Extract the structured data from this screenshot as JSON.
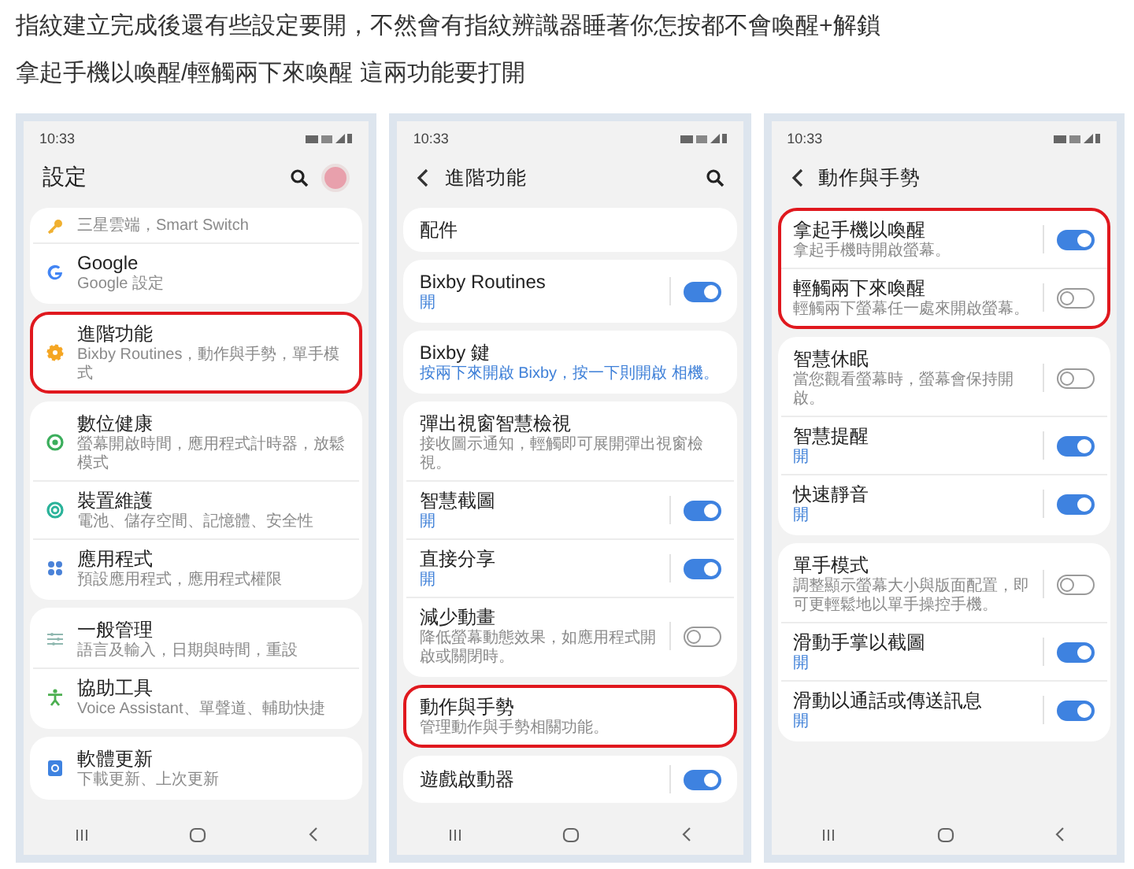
{
  "intro": [
    "指紋建立完成後還有些設定要開，不然會有指紋辨識器睡著你怎按都不會喚醒+解鎖",
    "拿起手機以喚醒/輕觸兩下來喚醒 這兩功能要打開"
  ],
  "phones": [
    {
      "time": "10:33",
      "title": "設定",
      "back_button": false,
      "search_button": true,
      "profile_avatar": true,
      "cards": [
        {
          "highlighted": false,
          "items": [
            {
              "kind": "link",
              "subtitle": "三星雲端，Smart Switch",
              "subtitle_highlighted": false
            },
            {
              "kind": "link",
              "title": "Google",
              "subtitle": "Google 設定",
              "subtitle_highlighted": false
            }
          ]
        },
        {
          "highlighted": true,
          "items": [
            {
              "kind": "link",
              "title": "進階功能",
              "subtitle": "Bixby Routines，動作與手勢，單手模式",
              "subtitle_highlighted": false
            }
          ]
        },
        {
          "highlighted": false,
          "items": [
            {
              "kind": "link",
              "title": "數位健康",
              "subtitle": "螢幕開啟時間，應用程式計時器，放鬆模式",
              "subtitle_highlighted": false
            },
            {
              "kind": "link",
              "title": "裝置維護",
              "subtitle": "電池、儲存空間、記憶體、安全性",
              "subtitle_highlighted": false
            },
            {
              "kind": "link",
              "title": "應用程式",
              "subtitle": "預設應用程式，應用程式權限",
              "subtitle_highlighted": false
            }
          ]
        },
        {
          "highlighted": false,
          "items": [
            {
              "kind": "link",
              "title": "一般管理",
              "subtitle": "語言及輸入，日期與時間，重設",
              "subtitle_highlighted": false
            },
            {
              "kind": "link",
              "title": "協助工具",
              "subtitle": "Voice Assistant、單聲道、輔助快捷",
              "subtitle_highlighted": false
            }
          ]
        },
        {
          "highlighted": false,
          "items": [
            {
              "kind": "link",
              "title": "軟體更新",
              "subtitle": "下載更新、上次更新",
              "subtitle_highlighted": false
            }
          ]
        }
      ]
    },
    {
      "time": "10:33",
      "title": "進階功能",
      "back_button": true,
      "search_button": true,
      "profile_avatar": false,
      "cards": [
        {
          "highlighted": false,
          "items": [
            {
              "kind": "link",
              "title": "配件"
            }
          ]
        },
        {
          "highlighted": false,
          "items": [
            {
              "kind": "toggle",
              "title": "Bixby Routines",
              "subtitle": "開",
              "subtitle_highlighted": true,
              "on": true
            }
          ]
        },
        {
          "highlighted": false,
          "items": [
            {
              "kind": "link",
              "title": "Bixby 鍵",
              "subtitle": "按兩下來開啟 Bixby，按一下則開啟 相機。",
              "subtitle_highlighted": true
            }
          ]
        },
        {
          "highlighted": false,
          "items": [
            {
              "kind": "link",
              "title": "彈出視窗智慧檢視",
              "subtitle": "接收圖示通知，輕觸即可展開彈出視窗檢視。",
              "subtitle_highlighted": false
            },
            {
              "kind": "toggle",
              "title": "智慧截圖",
              "subtitle": "開",
              "subtitle_highlighted": true,
              "on": true
            },
            {
              "kind": "toggle",
              "title": "直接分享",
              "subtitle": "開",
              "subtitle_highlighted": true,
              "on": true
            },
            {
              "kind": "toggle",
              "title": "減少動畫",
              "subtitle": "降低螢幕動態效果，如應用程式開啟或關閉時。",
              "subtitle_highlighted": false,
              "on": false
            }
          ]
        },
        {
          "highlighted": true,
          "items": [
            {
              "kind": "link",
              "title": "動作與手勢",
              "subtitle": "管理動作與手勢相關功能。",
              "subtitle_highlighted": false
            }
          ]
        },
        {
          "highlighted": false,
          "items": [
            {
              "kind": "toggle",
              "title": "遊戲啟動器",
              "on": true
            }
          ]
        }
      ]
    },
    {
      "time": "10:33",
      "title": "動作與手勢",
      "back_button": true,
      "search_button": false,
      "profile_avatar": false,
      "cards": [
        {
          "highlighted": true,
          "items": [
            {
              "kind": "toggle",
              "title": "拿起手機以喚醒",
              "subtitle": "拿起手機時開啟螢幕。",
              "subtitle_highlighted": false,
              "on": true
            },
            {
              "kind": "toggle",
              "title": "輕觸兩下來喚醒",
              "subtitle": "輕觸兩下螢幕任一處來開啟螢幕。",
              "subtitle_highlighted": false,
              "on": false
            }
          ]
        },
        {
          "highlighted": false,
          "items": [
            {
              "kind": "toggle",
              "title": "智慧休眠",
              "subtitle": "當您觀看螢幕時，螢幕會保持開啟。",
              "subtitle_highlighted": false,
              "on": false
            },
            {
              "kind": "toggle",
              "title": "智慧提醒",
              "subtitle": "開",
              "subtitle_highlighted": true,
              "on": true
            },
            {
              "kind": "toggle",
              "title": "快速靜音",
              "subtitle": "開",
              "subtitle_highlighted": true,
              "on": true
            }
          ]
        },
        {
          "highlighted": false,
          "items": [
            {
              "kind": "toggle",
              "title": "單手模式",
              "subtitle": "調整顯示螢幕大小與版面配置，即可更輕鬆地以單手操控手機。",
              "subtitle_highlighted": false,
              "on": false
            },
            {
              "kind": "toggle",
              "title": "滑動手掌以截圖",
              "subtitle": "開",
              "subtitle_highlighted": true,
              "on": true
            },
            {
              "kind": "toggle",
              "title": "滑動以通話或傳送訊息",
              "subtitle": "開",
              "subtitle_highlighted": true,
              "on": true
            }
          ]
        }
      ]
    }
  ]
}
